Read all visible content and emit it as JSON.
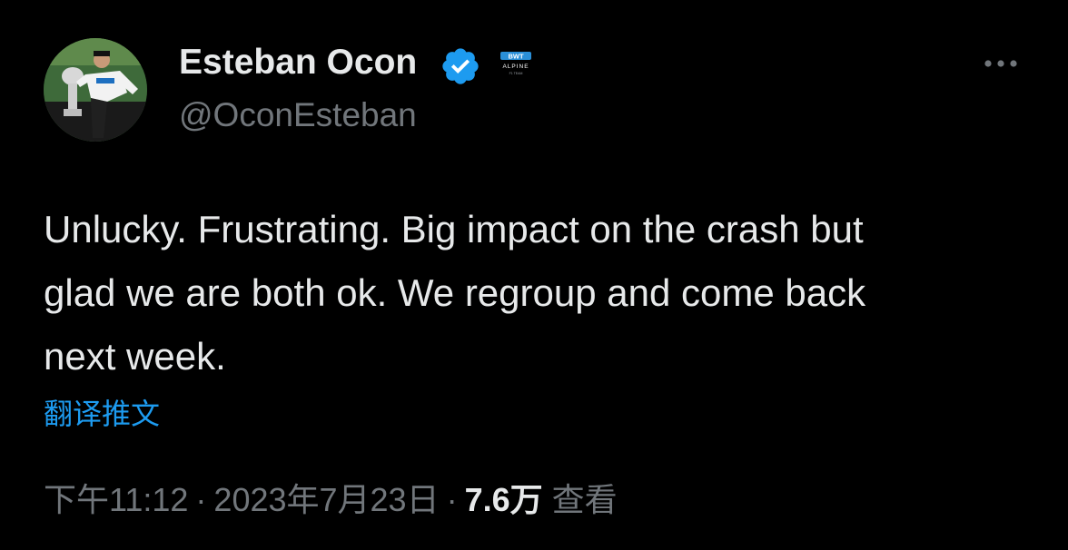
{
  "tweet": {
    "author": {
      "display_name": "Esteban Ocon",
      "handle": "@OconEsteban",
      "verified": true,
      "affiliate_badge_text": "BWT ALPINE F1 TEAM"
    },
    "text_lines": [
      "Unlucky. Frustrating. Big impact on the crash but",
      "glad we are both ok. We regroup and come back",
      "next week."
    ],
    "translate_label": "翻译推文",
    "meta": {
      "time": "下午11:12",
      "separator": "·",
      "date": "2023年7月23日",
      "views_count": "7.6万",
      "views_label": "查看"
    }
  },
  "icons": {
    "verified": "verified-badge-icon",
    "affiliate": "alpine-affiliate-badge-icon",
    "more": "more-options-icon"
  },
  "colors": {
    "background": "#000000",
    "primary_text": "#e7e9ea",
    "secondary_text": "#71767b",
    "link": "#1d9bf0",
    "verified_badge": "#1d9bf0"
  }
}
